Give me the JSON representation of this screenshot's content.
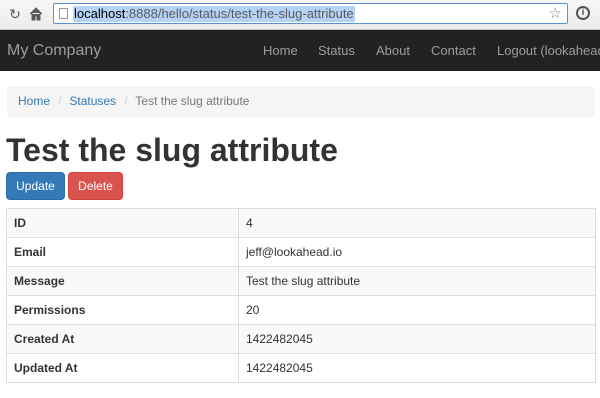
{
  "browser": {
    "url_host": "localhost",
    "url_rest": ":8888/hello/status/test-the-slug-attribute",
    "icons": [
      "reload-icon",
      "home-icon",
      "page-icon",
      "bookmark-star-icon",
      "info-icon"
    ]
  },
  "navbar": {
    "brand": "My Company",
    "items": [
      "Home",
      "Status",
      "About",
      "Contact",
      "Logout (lookahead"
    ]
  },
  "breadcrumb": {
    "items": [
      "Home",
      "Statuses"
    ],
    "active": "Test the slug attribute"
  },
  "page": {
    "title": "Test the slug attribute"
  },
  "actions": {
    "update_label": "Update",
    "delete_label": "Delete"
  },
  "details": {
    "rows": [
      {
        "label": "ID",
        "value": "4"
      },
      {
        "label": "Email",
        "value": "jeff@lookahead.io"
      },
      {
        "label": "Message",
        "value": "Test the slug attribute"
      },
      {
        "label": "Permissions",
        "value": "20"
      },
      {
        "label": "Created At",
        "value": "1422482045"
      },
      {
        "label": "Updated At",
        "value": "1422482045"
      }
    ]
  },
  "colors": {
    "navbar_bg": "#222222",
    "link": "#337ab7",
    "primary": "#337ab7",
    "danger": "#d9534f"
  }
}
